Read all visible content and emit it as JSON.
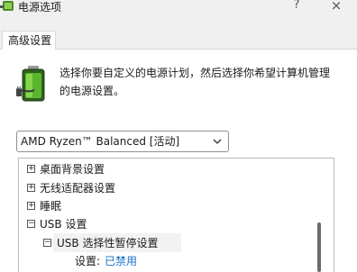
{
  "window": {
    "title": "电源选项",
    "help_label": "?",
    "close_label": "×"
  },
  "tabs": [
    {
      "label": "高级设置"
    }
  ],
  "description": {
    "line1": "选择你要自定义的电源计划，然后选择你希望计算机管理",
    "line2": "的电源设置。"
  },
  "plan_select": {
    "value": "AMD Ryzen™ Balanced [活动]"
  },
  "tree": {
    "items": [
      {
        "label": "桌面背景设置",
        "expander": "+"
      },
      {
        "label": "无线适配器设置",
        "expander": "+"
      },
      {
        "label": "睡眠",
        "expander": "+"
      },
      {
        "label": "USB 设置",
        "expander": "−"
      },
      {
        "label": "USB 选择性暂停设置",
        "expander": "−"
      }
    ],
    "setting": {
      "label": "设置:",
      "value": "已禁用"
    }
  },
  "colors": {
    "accent_value": "#1a6fc9",
    "dialog_bg": "#f0f0f0"
  }
}
